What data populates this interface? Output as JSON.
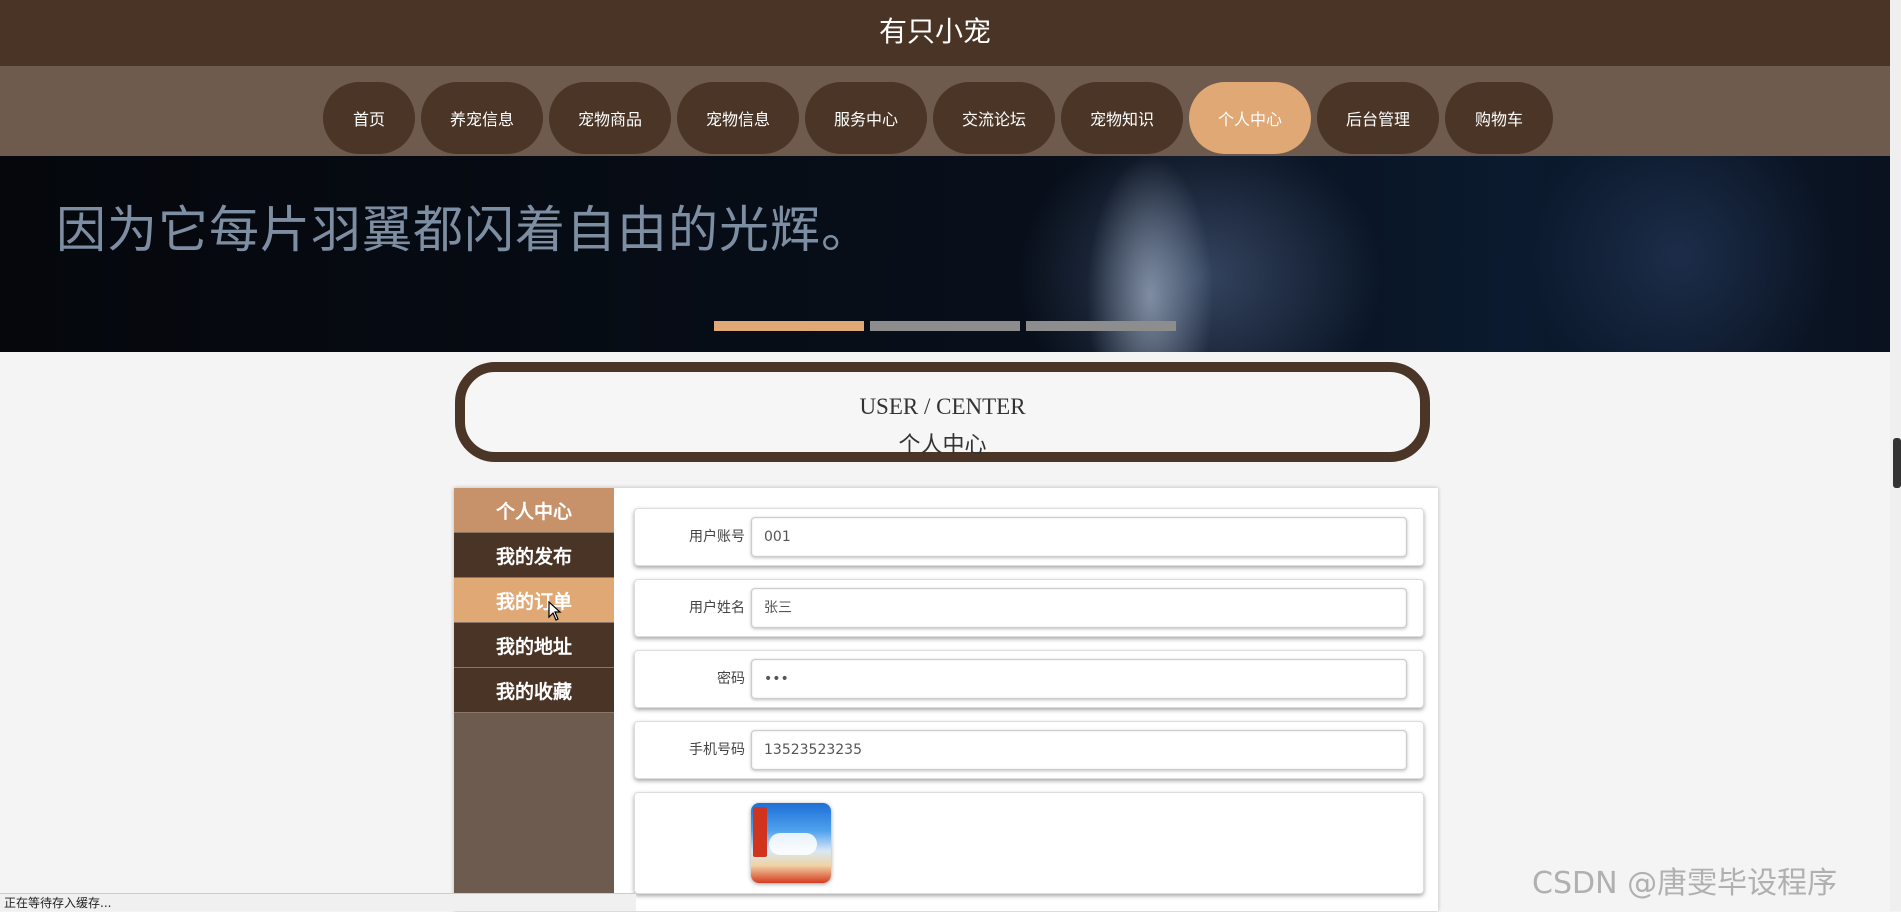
{
  "header": {
    "site_title": "有只小宠"
  },
  "nav": {
    "items": [
      {
        "label": "首页"
      },
      {
        "label": "养宠信息"
      },
      {
        "label": "宠物商品"
      },
      {
        "label": "宠物信息"
      },
      {
        "label": "服务中心"
      },
      {
        "label": "交流论坛"
      },
      {
        "label": "宠物知识"
      },
      {
        "label": "个人中心",
        "active": true
      },
      {
        "label": "后台管理"
      },
      {
        "label": "购物车"
      }
    ]
  },
  "banner": {
    "text": "因为它每片羽翼都闪着自由的光辉。",
    "slides": 3,
    "active_slide": 1
  },
  "section": {
    "title_en": "USER / CENTER",
    "title_cn": "个人中心"
  },
  "sidebar": {
    "items": [
      {
        "label": "个人中心"
      },
      {
        "label": "我的发布"
      },
      {
        "label": "我的订单"
      },
      {
        "label": "我的地址"
      },
      {
        "label": "我的收藏"
      }
    ]
  },
  "form": {
    "account_label": "用户账号",
    "account_value": "001",
    "name_label": "用户姓名",
    "name_value": "张三",
    "password_label": "密码",
    "password_value": "•••",
    "phone_label": "手机号码",
    "phone_value": "13523523235"
  },
  "statusbar": {
    "text": "正在等待存入缓存..."
  },
  "watermark": {
    "text": "CSDN @唐雯毕设程序"
  },
  "colors": {
    "brown_dark": "#4a3426",
    "brown_mid": "#6f5a4e",
    "accent": "#dfa874"
  }
}
